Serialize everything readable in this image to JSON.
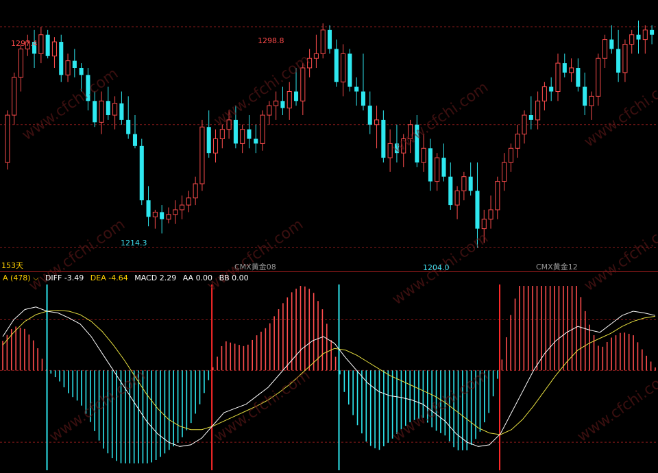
{
  "colors": {
    "up": "#ff4d4d",
    "down": "#2ee8f0",
    "diff": "#ffffff",
    "dea": "#e8e040",
    "grid": "#8a1a1a",
    "cross_up": "#ff2a2a",
    "cross_down": "#2ee8f0"
  },
  "main": {
    "annotations": {
      "high1": "1297.4",
      "high2": "1298.8",
      "low1": "1214.3",
      "low2": "1204.0"
    },
    "period_label": "153天",
    "contract_labels": [
      "CMX黄金08",
      "CMX黄金12"
    ],
    "watermark": "www.cfchi.com"
  },
  "indicator": {
    "name": "A (478)",
    "diff_label": "DIFF",
    "diff_value": "-3.49",
    "dea_label": "DEA",
    "dea_value": "-4.64",
    "macd_label": "MACD",
    "macd_value": "2.29",
    "aa_label": "AA",
    "aa_value": "0.00",
    "bb_label": "BB",
    "bb_value": "0.00"
  },
  "chart_data": [
    {
      "type": "candlestick",
      "title": "",
      "ylim": [
        1200,
        1300
      ],
      "series": [
        {
          "name": "",
          "ohlc": [
            [
              1240,
              1262,
              1237,
              1260
            ],
            [
              1260,
              1278,
              1256,
              1276
            ],
            [
              1276,
              1290,
              1270,
              1288
            ],
            [
              1288,
              1294,
              1285,
              1291
            ],
            [
              1291,
              1296,
              1280,
              1286
            ],
            [
              1286,
              1297.4,
              1282,
              1294
            ],
            [
              1294,
              1296,
              1284,
              1285
            ],
            [
              1285,
              1293,
              1280,
              1291
            ],
            [
              1291,
              1294,
              1274,
              1277
            ],
            [
              1277,
              1286,
              1274,
              1283
            ],
            [
              1283,
              1288,
              1276,
              1280
            ],
            [
              1280,
              1282,
              1270,
              1277
            ],
            [
              1277,
              1280,
              1262,
              1266
            ],
            [
              1266,
              1270,
              1255,
              1257
            ],
            [
              1257,
              1270,
              1252,
              1266
            ],
            [
              1266,
              1272,
              1258,
              1260
            ],
            [
              1260,
              1268,
              1254,
              1265
            ],
            [
              1265,
              1270,
              1256,
              1258
            ],
            [
              1258,
              1268,
              1250,
              1252
            ],
            [
              1252,
              1260,
              1246,
              1247
            ],
            [
              1247,
              1250,
              1222,
              1224
            ],
            [
              1224,
              1230,
              1213,
              1217
            ],
            [
              1217,
              1220,
              1212,
              1219
            ],
            [
              1219,
              1222,
              1210,
              1216
            ],
            [
              1216,
              1221,
              1214.3,
              1218
            ],
            [
              1218,
              1224,
              1214,
              1220
            ],
            [
              1220,
              1226,
              1216,
              1222
            ],
            [
              1222,
              1228,
              1219,
              1225
            ],
            [
              1225,
              1234,
              1222,
              1231
            ],
            [
              1231,
              1258,
              1228,
              1255
            ],
            [
              1255,
              1262,
              1242,
              1244
            ],
            [
              1244,
              1254,
              1240,
              1250
            ],
            [
              1250,
              1256,
              1246,
              1254
            ],
            [
              1254,
              1262,
              1250,
              1258
            ],
            [
              1258,
              1264,
              1246,
              1248
            ],
            [
              1248,
              1256,
              1244,
              1254
            ],
            [
              1254,
              1260,
              1246,
              1250
            ],
            [
              1250,
              1256,
              1244,
              1248
            ],
            [
              1248,
              1262,
              1245,
              1260
            ],
            [
              1260,
              1266,
              1256,
              1264
            ],
            [
              1264,
              1270,
              1258,
              1266
            ],
            [
              1266,
              1272,
              1260,
              1263
            ],
            [
              1263,
              1274,
              1258,
              1270
            ],
            [
              1270,
              1280,
              1264,
              1266
            ],
            [
              1266,
              1282,
              1260,
              1280
            ],
            [
              1280,
              1288,
              1276,
              1284
            ],
            [
              1284,
              1294,
              1280,
              1286
            ],
            [
              1286,
              1298.8,
              1284,
              1296
            ],
            [
              1296,
              1298,
              1286,
              1288
            ],
            [
              1288,
              1292,
              1272,
              1274
            ],
            [
              1274,
              1290,
              1268,
              1286
            ],
            [
              1286,
              1288,
              1270,
              1272
            ],
            [
              1272,
              1276,
              1264,
              1270
            ],
            [
              1270,
              1286,
              1262,
              1264
            ],
            [
              1264,
              1270,
              1252,
              1256
            ],
            [
              1256,
              1264,
              1246,
              1258
            ],
            [
              1258,
              1262,
              1240,
              1242
            ],
            [
              1242,
              1254,
              1236,
              1248
            ],
            [
              1248,
              1256,
              1240,
              1244
            ],
            [
              1244,
              1252,
              1238,
              1250
            ],
            [
              1250,
              1258,
              1244,
              1256
            ],
            [
              1256,
              1260,
              1238,
              1240
            ],
            [
              1240,
              1252,
              1236,
              1246
            ],
            [
              1246,
              1250,
              1228,
              1232
            ],
            [
              1232,
              1244,
              1228,
              1242
            ],
            [
              1242,
              1248,
              1232,
              1234
            ],
            [
              1234,
              1240,
              1220,
              1222
            ],
            [
              1222,
              1230,
              1216,
              1228
            ],
            [
              1228,
              1236,
              1224,
              1234
            ],
            [
              1234,
              1240,
              1226,
              1228
            ],
            [
              1228,
              1240,
              1204.0,
              1212
            ],
            [
              1212,
              1220,
              1206,
              1216
            ],
            [
              1216,
              1226,
              1212,
              1220
            ],
            [
              1220,
              1234,
              1216,
              1232
            ],
            [
              1232,
              1244,
              1228,
              1240
            ],
            [
              1240,
              1248,
              1236,
              1246
            ],
            [
              1246,
              1256,
              1242,
              1252
            ],
            [
              1252,
              1262,
              1248,
              1260
            ],
            [
              1260,
              1268,
              1254,
              1258
            ],
            [
              1258,
              1270,
              1254,
              1266
            ],
            [
              1266,
              1274,
              1262,
              1272
            ],
            [
              1272,
              1276,
              1266,
              1270
            ],
            [
              1270,
              1286,
              1266,
              1282
            ],
            [
              1282,
              1286,
              1276,
              1278
            ],
            [
              1278,
              1284,
              1274,
              1280
            ],
            [
              1280,
              1284,
              1270,
              1272
            ],
            [
              1272,
              1278,
              1260,
              1264
            ],
            [
              1264,
              1270,
              1258,
              1268
            ],
            [
              1268,
              1286,
              1264,
              1284
            ],
            [
              1284,
              1294,
              1280,
              1292
            ],
            [
              1292,
              1298,
              1286,
              1288
            ],
            [
              1288,
              1296,
              1274,
              1278
            ],
            [
              1278,
              1292,
              1274,
              1290
            ],
            [
              1290,
              1296,
              1286,
              1294
            ],
            [
              1294,
              1300,
              1286,
              1292
            ],
            [
              1292,
              1298,
              1286,
              1296
            ],
            [
              1296,
              1298,
              1290,
              1294
            ]
          ]
        }
      ]
    },
    {
      "type": "line",
      "title": "",
      "ylim": [
        -11,
        10
      ],
      "series": [
        {
          "name": "DIFF",
          "values": [
            4,
            6,
            7.2,
            7.5,
            7,
            6.8,
            6.2,
            5.5,
            4,
            2,
            0,
            -2,
            -4,
            -6,
            -7.5,
            -8.5,
            -9,
            -8.8,
            -8,
            -6.5,
            -5,
            -4.5,
            -4,
            -3,
            -2,
            -0.5,
            1,
            2.5,
            3.5,
            4,
            3.2,
            1.5,
            0,
            -1.5,
            -2.5,
            -3,
            -3.2,
            -3.5,
            -4,
            -5,
            -6,
            -7.5,
            -8.5,
            -9,
            -8.8,
            -7.5,
            -5,
            -2.5,
            0,
            2,
            3.5,
            4.5,
            5.2,
            4.8,
            4.5,
            5.5,
            6.5,
            7,
            6.8,
            6.5
          ]
        },
        {
          "name": "DEA",
          "values": [
            3,
            4.5,
            5.8,
            6.6,
            7,
            7.1,
            7,
            6.6,
            5.8,
            4.6,
            3,
            1.2,
            -0.8,
            -2.8,
            -4.5,
            -5.8,
            -6.6,
            -7,
            -7,
            -6.6,
            -6,
            -5.4,
            -4.8,
            -4.2,
            -3.5,
            -2.6,
            -1.6,
            -0.4,
            0.8,
            2,
            2.6,
            2.4,
            1.8,
            1,
            0.2,
            -0.6,
            -1.2,
            -1.8,
            -2.4,
            -3,
            -3.8,
            -4.8,
            -5.8,
            -6.8,
            -7.4,
            -7.6,
            -7,
            -5.8,
            -4.2,
            -2.4,
            -0.6,
            1,
            2.4,
            3.2,
            3.8,
            4.4,
            5.2,
            5.8,
            6.2,
            6.4
          ]
        }
      ]
    }
  ]
}
